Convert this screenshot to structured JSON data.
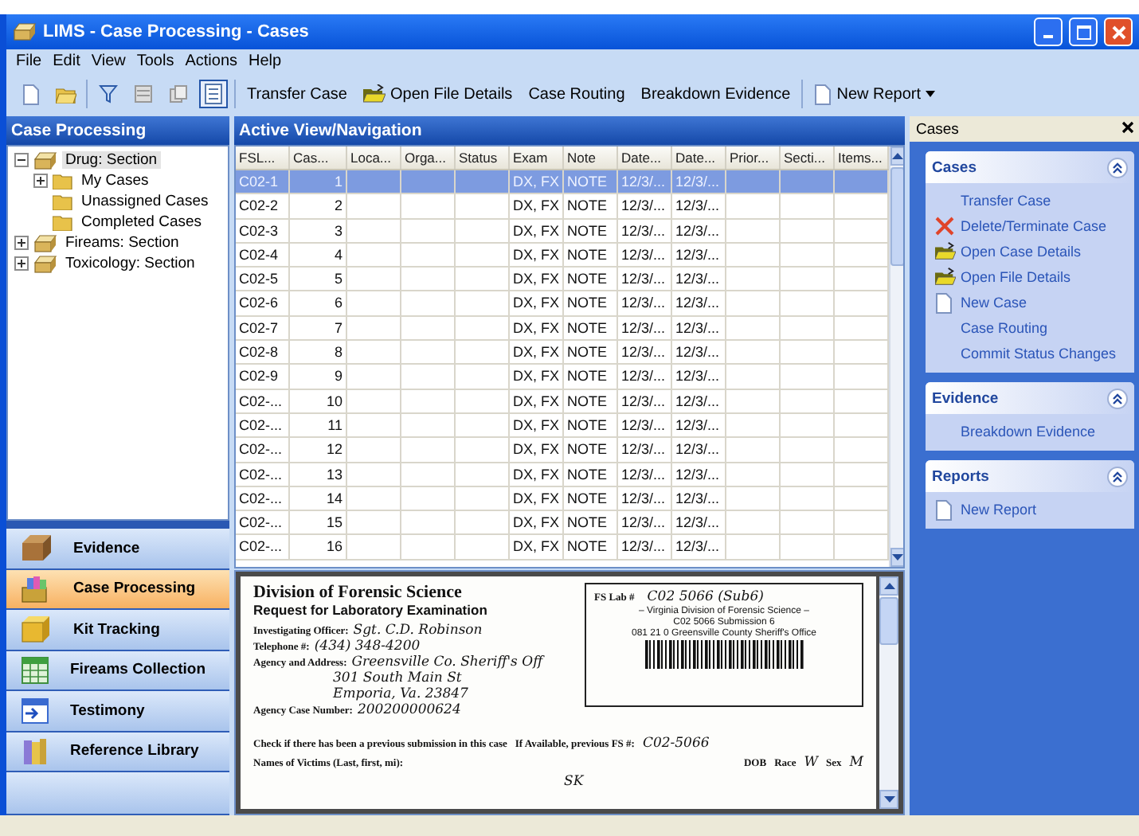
{
  "window": {
    "title": "LIMS - Case Processing - Cases"
  },
  "menu": [
    "File",
    "Edit",
    "View",
    "Tools",
    "Actions",
    "Help"
  ],
  "toolbar": {
    "view_toggle_on": true,
    "actions": [
      {
        "label": "Transfer Case",
        "kind": "plain"
      },
      {
        "label": "Open File Details",
        "kind": "open"
      },
      {
        "label": "Case Routing",
        "kind": "plain"
      },
      {
        "label": "Breakdown Evidence",
        "kind": "plain"
      },
      {
        "label": "New Report",
        "kind": "new-dropdown"
      }
    ]
  },
  "left_pane": {
    "title": "Case Processing",
    "tree": [
      {
        "label": "Drug: Section",
        "kind": "section",
        "expanded": true,
        "selected": true,
        "children": [
          {
            "label": "My Cases",
            "kind": "folder",
            "expanded": false,
            "selected": false
          },
          {
            "label": "Unassigned Cases",
            "kind": "folder",
            "selected": false
          },
          {
            "label": "Completed Cases",
            "kind": "folder",
            "selected": false
          }
        ]
      },
      {
        "label": "Fireams: Section",
        "kind": "section",
        "expanded": false,
        "selected": false
      },
      {
        "label": "Toxicology: Section",
        "kind": "section",
        "expanded": false,
        "selected": false
      }
    ],
    "nav": [
      {
        "label": "Evidence",
        "kind": "box",
        "selected": false
      },
      {
        "label": "Case Processing",
        "kind": "cards",
        "selected": true
      },
      {
        "label": "Kit Tracking",
        "kind": "kit",
        "selected": false
      },
      {
        "label": "Fireams Collection",
        "kind": "grid",
        "selected": false
      },
      {
        "label": "Testimony",
        "kind": "calendar",
        "selected": false
      },
      {
        "label": "Reference Library",
        "kind": "books",
        "selected": false
      }
    ]
  },
  "center": {
    "title": "Active View/Navigation",
    "table": {
      "columns": [
        "FSL...",
        "Cas...",
        "Loca...",
        "Orga...",
        "Status",
        "Exam",
        "Note",
        "Date...",
        "Date...",
        "Prior...",
        "Secti...",
        "Items..."
      ],
      "rows": [
        {
          "selected": true,
          "cells": [
            "C02-1",
            "1",
            "",
            "",
            "",
            "DX, FX",
            "NOTE",
            "12/3/...",
            "12/3/...",
            "",
            "",
            ""
          ]
        },
        {
          "selected": false,
          "cells": [
            "C02-2",
            "2",
            "",
            "",
            "",
            "DX, FX",
            "NOTE",
            "12/3/...",
            "12/3/...",
            "",
            "",
            ""
          ]
        },
        {
          "selected": false,
          "cells": [
            "C02-3",
            "3",
            "",
            "",
            "",
            "DX, FX",
            "NOTE",
            "12/3/...",
            "12/3/...",
            "",
            "",
            ""
          ]
        },
        {
          "selected": false,
          "cells": [
            "C02-4",
            "4",
            "",
            "",
            "",
            "DX, FX",
            "NOTE",
            "12/3/...",
            "12/3/...",
            "",
            "",
            ""
          ]
        },
        {
          "selected": false,
          "cells": [
            "C02-5",
            "5",
            "",
            "",
            "",
            "DX, FX",
            "NOTE",
            "12/3/...",
            "12/3/...",
            "",
            "",
            ""
          ]
        },
        {
          "selected": false,
          "cells": [
            "C02-6",
            "6",
            "",
            "",
            "",
            "DX, FX",
            "NOTE",
            "12/3/...",
            "12/3/...",
            "",
            "",
            ""
          ]
        },
        {
          "selected": false,
          "cells": [
            "C02-7",
            "7",
            "",
            "",
            "",
            "DX, FX",
            "NOTE",
            "12/3/...",
            "12/3/...",
            "",
            "",
            ""
          ]
        },
        {
          "selected": false,
          "cells": [
            "C02-8",
            "8",
            "",
            "",
            "",
            "DX, FX",
            "NOTE",
            "12/3/...",
            "12/3/...",
            "",
            "",
            ""
          ]
        },
        {
          "selected": false,
          "cells": [
            "C02-9",
            "9",
            "",
            "",
            "",
            "DX, FX",
            "NOTE",
            "12/3/...",
            "12/3/...",
            "",
            "",
            ""
          ]
        },
        {
          "selected": false,
          "cells": [
            "C02-...",
            "10",
            "",
            "",
            "",
            "DX, FX",
            "NOTE",
            "12/3/...",
            "12/3/...",
            "",
            "",
            ""
          ]
        },
        {
          "selected": false,
          "cells": [
            "C02-...",
            "11",
            "",
            "",
            "",
            "DX, FX",
            "NOTE",
            "12/3/...",
            "12/3/...",
            "",
            "",
            ""
          ]
        },
        {
          "selected": false,
          "cells": [
            "C02-...",
            "12",
            "",
            "",
            "",
            "DX, FX",
            "NOTE",
            "12/3/...",
            "12/3/...",
            "",
            "",
            ""
          ]
        },
        {
          "selected": false,
          "cells": [
            "C02-...",
            "13",
            "",
            "",
            "",
            "DX, FX",
            "NOTE",
            "12/3/...",
            "12/3/...",
            "",
            "",
            ""
          ]
        },
        {
          "selected": false,
          "cells": [
            "C02-...",
            "14",
            "",
            "",
            "",
            "DX, FX",
            "NOTE",
            "12/3/...",
            "12/3/...",
            "",
            "",
            ""
          ]
        },
        {
          "selected": false,
          "cells": [
            "C02-...",
            "15",
            "",
            "",
            "",
            "DX, FX",
            "NOTE",
            "12/3/...",
            "12/3/...",
            "",
            "",
            ""
          ]
        },
        {
          "selected": false,
          "cells": [
            "C02-...",
            "16",
            "",
            "",
            "",
            "DX, FX",
            "NOTE",
            "12/3/...",
            "12/3/...",
            "",
            "",
            ""
          ]
        }
      ]
    },
    "document": {
      "title": "Division of Forensic Science",
      "subtitle": "Request for Laboratory Examination",
      "fields": [
        {
          "label": "Investigating Officer:",
          "value": "Sgt. C.D. Robinson"
        },
        {
          "label": "Telephone #:",
          "value": "(434) 348-4200"
        },
        {
          "label": "Agency and Address:",
          "value": "Greensville Co. Sheriff's Off"
        },
        {
          "value": "301 South Main St"
        },
        {
          "value": "Emporia, Va. 23847"
        },
        {
          "label": "Agency Case Number:",
          "value": "200200000624"
        }
      ],
      "check_note": "Check if there has been a previous submission in this case",
      "previous": {
        "label": "If Available, previous FS #:",
        "value": "C02-5066"
      },
      "victims_label": "Names of Victims (Last, first, mi):",
      "dob_label": "DOB",
      "race_label": "Race",
      "race": "W",
      "sex_label": "Sex",
      "sex": "M",
      "initials": "SK",
      "lab_box": {
        "label": "FS Lab #",
        "value": "C02 5066 (Sub6)",
        "stamp": [
          "– Virginia Division of Forensic Science –",
          "C02 5066    Submission 6",
          "081 21 0 Greensville County Sheriff's Office"
        ]
      }
    }
  },
  "right_pane": {
    "title": "Cases",
    "groups": [
      {
        "title": "Cases",
        "items": [
          {
            "label": "Transfer Case",
            "kind": "plain"
          },
          {
            "label": "Delete/Terminate Case",
            "kind": "delete"
          },
          {
            "label": "Open Case Details",
            "kind": "open"
          },
          {
            "label": "Open File Details",
            "kind": "open"
          },
          {
            "label": "New Case",
            "kind": "new"
          },
          {
            "label": "Case Routing",
            "kind": "plain"
          },
          {
            "label": "Commit Status Changes",
            "kind": "plain"
          }
        ]
      },
      {
        "title": "Evidence",
        "items": [
          {
            "label": "Breakdown Evidence",
            "kind": "plain"
          }
        ]
      },
      {
        "title": "Reports",
        "items": [
          {
            "label": "New Report",
            "kind": "new"
          }
        ]
      }
    ]
  }
}
